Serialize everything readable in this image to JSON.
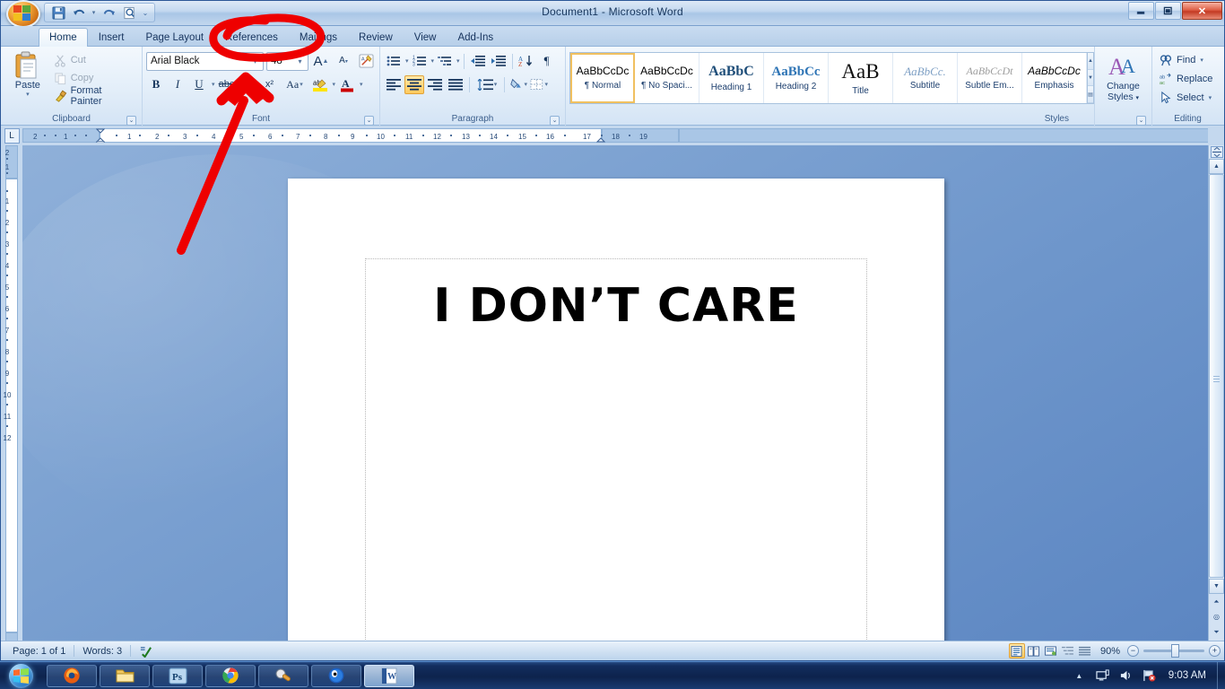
{
  "window": {
    "title": "Document1 - Microsoft Word",
    "minimize_label": "—",
    "restore_label": "❐",
    "close_label": "✕"
  },
  "quick_access": {
    "items": [
      {
        "name": "office-button",
        "label": "Office"
      },
      {
        "name": "save-button",
        "label": "Save"
      },
      {
        "name": "undo-button",
        "label": "Undo"
      },
      {
        "name": "redo-button",
        "label": "Redo"
      },
      {
        "name": "print-preview-button",
        "label": "Print Preview"
      },
      {
        "name": "customize-quick-access-button",
        "label": "Customize"
      }
    ]
  },
  "ribbon": {
    "tabs": [
      {
        "label": "Home",
        "active": true
      },
      {
        "label": "Insert",
        "active": false
      },
      {
        "label": "Page Layout",
        "active": false
      },
      {
        "label": "References",
        "active": false
      },
      {
        "label": "Mailings",
        "active": false
      },
      {
        "label": "Review",
        "active": false
      },
      {
        "label": "View",
        "active": false
      },
      {
        "label": "Add-Ins",
        "active": false
      }
    ],
    "groups": {
      "clipboard": {
        "label": "Clipboard",
        "paste_label": "Paste",
        "cut_label": "Cut",
        "copy_label": "Copy",
        "format_painter_label": "Format Painter"
      },
      "font": {
        "label": "Font",
        "font_name": "Arial Black",
        "font_size": "48",
        "grow_font_label": "A",
        "shrink_font_label": "A",
        "clear_formatting_label": "Aa",
        "bold_label": "B",
        "italic_label": "I",
        "underline_label": "U",
        "strikethrough_label": "abc",
        "subscript_label": "x₂",
        "superscript_label": "x²",
        "change_case_label": "Aa",
        "highlight_label": "ab",
        "font_color_label": "A"
      },
      "paragraph": {
        "label": "Paragraph",
        "bullets_label": "≔",
        "numbering_label": "≕",
        "multilevel_label": "≖",
        "decrease_indent_label": "⇤",
        "increase_indent_label": "⇥",
        "sort_label": "A↓",
        "show_marks_label": "¶",
        "align_left_label": "≡",
        "align_center_label": "≡",
        "align_right_label": "≡",
        "justify_label": "≡",
        "line_spacing_label": "↕≡",
        "shading_label": "▣",
        "borders_label": "▦",
        "active_alignment": "center"
      },
      "styles": {
        "label": "Styles",
        "items": [
          {
            "preview": "AaBbCcDc",
            "name": "¶ Normal",
            "selected": true
          },
          {
            "preview": "AaBbCcDc",
            "name": "¶ No Spaci...",
            "selected": false
          },
          {
            "preview": "AaBbC",
            "name": "Heading 1",
            "selected": false
          },
          {
            "preview": "AaBbCc",
            "name": "Heading 2",
            "selected": false
          },
          {
            "preview": "AaB",
            "name": "Title",
            "selected": false
          },
          {
            "preview": "AaBbCc.",
            "name": "Subtitle",
            "selected": false
          },
          {
            "preview": "AaBbCcDt",
            "name": "Subtle Em...",
            "selected": false
          },
          {
            "preview": "AaBbCcDc",
            "name": "Emphasis",
            "selected": false
          }
        ],
        "change_styles_label": "Change\nStyles"
      },
      "editing": {
        "label": "Editing",
        "find_label": "Find",
        "replace_label": "Replace",
        "select_label": "Select"
      }
    }
  },
  "ruler": {
    "tab_selector_label": "L",
    "horizontal_ticks": [
      "2",
      "1",
      "1",
      "2",
      "3",
      "4",
      "5",
      "6",
      "7",
      "8",
      "9",
      "10",
      "11",
      "12",
      "13",
      "14",
      "15",
      "16",
      "17",
      "18",
      "19"
    ],
    "vertical_ticks": [
      "2",
      "1",
      "1",
      "2",
      "3",
      "4",
      "5",
      "6",
      "7",
      "8",
      "9",
      "10",
      "11",
      "12"
    ]
  },
  "document": {
    "text": "I DON’T CARE"
  },
  "status_bar": {
    "page_label": "Page: 1 of 1",
    "words_label": "Words: 3",
    "proofing_label": "Proofing errors",
    "views": [
      {
        "name": "print-layout",
        "glyph": "▤",
        "active": true
      },
      {
        "name": "full-screen-reading",
        "glyph": "▥",
        "active": false
      },
      {
        "name": "web-layout",
        "glyph": "▦",
        "active": false
      },
      {
        "name": "outline",
        "glyph": "▧",
        "active": false
      },
      {
        "name": "draft",
        "glyph": "▨",
        "active": false
      }
    ],
    "zoom_level": "90%",
    "zoom_out_label": "−",
    "zoom_in_label": "+"
  },
  "taskbar": {
    "start_label": "Start",
    "items": [
      {
        "name": "taskbar-firefox",
        "label": "Mozilla Firefox",
        "active": false
      },
      {
        "name": "taskbar-explorer",
        "label": "Windows Explorer",
        "active": false
      },
      {
        "name": "taskbar-photoshop",
        "label": "Adobe Photoshop",
        "active": false
      },
      {
        "name": "taskbar-chrome",
        "label": "Google Chrome",
        "active": false
      },
      {
        "name": "taskbar-tool",
        "label": "Utility",
        "active": false
      },
      {
        "name": "taskbar-blue-app",
        "label": "Application",
        "active": false
      },
      {
        "name": "taskbar-word",
        "label": "Microsoft Word",
        "active": true
      }
    ],
    "tray": {
      "show_hidden_label": "▲",
      "network_label": "Network",
      "volume_label": "Volume",
      "action_center_label": "Action Center",
      "time": "9:03 AM"
    }
  },
  "annotation": {
    "color": "#ee0000",
    "ellipse_target": "References",
    "arrow_target": "Font group"
  },
  "colors": {
    "accent": "#2b5797",
    "annotation_red": "#ee0000",
    "highlight_orange": "#ffca5e"
  }
}
